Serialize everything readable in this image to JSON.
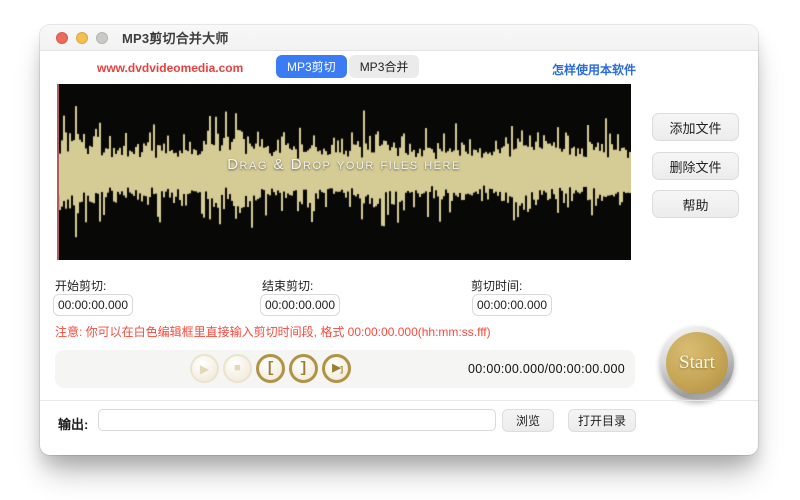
{
  "window": {
    "title": "MP3剪切合并大师"
  },
  "header": {
    "website_link": "www.dvdvideomedia.com",
    "tabs": [
      {
        "label": "MP3剪切",
        "active": true
      },
      {
        "label": "MP3合并",
        "active": false
      }
    ],
    "help_link": "怎样使用本软件"
  },
  "waveform": {
    "drop_hint": "Drag & Drop your files here",
    "wave_color": "#d5cb94",
    "background": "#080806",
    "playhead_color": "#b05a61"
  },
  "file_buttons": [
    {
      "label": "添加文件"
    },
    {
      "label": "删除文件"
    },
    {
      "label": "帮助"
    }
  ],
  "trim": {
    "fields": [
      {
        "label": "开始剪切:",
        "value": "00:00:00.000"
      },
      {
        "label": "结束剪切:",
        "value": "00:00:00.000"
      },
      {
        "label": "剪切时间:",
        "value": "00:00:00.000"
      }
    ],
    "note": "注意: 你可以在白色编辑框里直接输入剪切时间段, 格式 00:00:00.000(hh:mm:ss.fff)"
  },
  "player": {
    "buttons": [
      {
        "icon": "play-icon",
        "glyph": "▶",
        "state": "disabled"
      },
      {
        "icon": "stop-icon",
        "glyph": "■",
        "state": "disabled"
      },
      {
        "icon": "mark-start-icon",
        "glyph": "[",
        "state": "enabled"
      },
      {
        "icon": "mark-end-icon",
        "glyph": "]",
        "state": "enabled"
      },
      {
        "icon": "play-selection-icon",
        "glyph": "▶",
        "glyph2": "]",
        "state": "enabled"
      }
    ],
    "time_display": "00:00:00.000/00:00:00.000"
  },
  "start_button_label": "Start",
  "output": {
    "label": "输出:",
    "value": "",
    "browse_label": "浏览",
    "open_dir_label": "打开目录"
  },
  "colors": {
    "accent_blue": "#3b7cf5",
    "link_red": "#e8413d",
    "note_red": "#f84a3e",
    "gold": "#b09345",
    "wave": "#d5cb94"
  }
}
